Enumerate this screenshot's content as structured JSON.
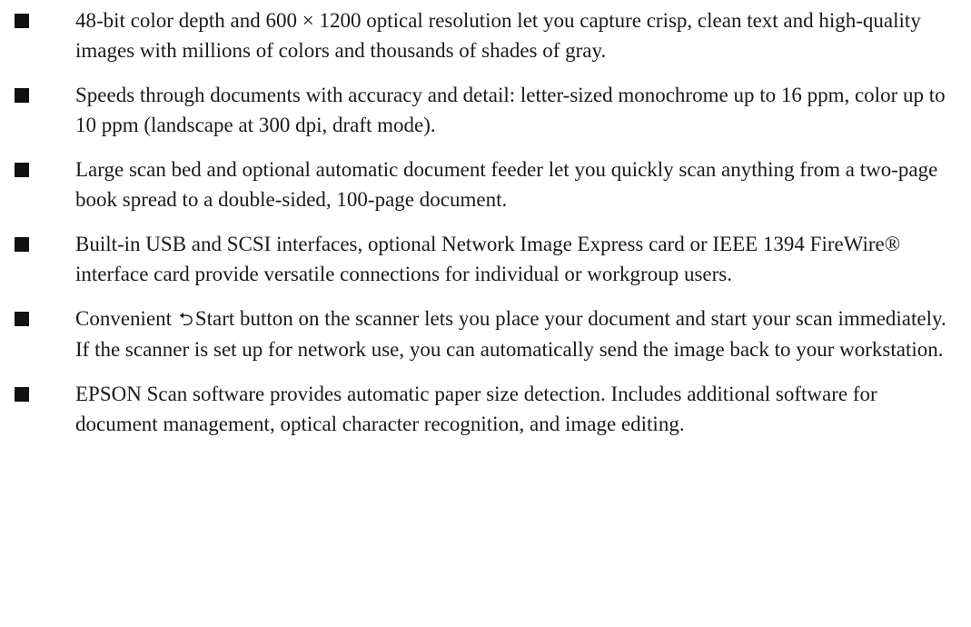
{
  "features": [
    "48-bit color depth and 600 × 1200 optical resolution let you capture crisp, clean text and high-quality images with millions of colors and thousands of shades of gray.",
    "Speeds through documents with accuracy and detail: letter-sized monochrome up to 16 ppm, color up to 10 ppm (landscape at 300 dpi, draft mode).",
    "Large scan bed and optional automatic document feeder let you quickly scan anything from a two-page book spread to a double-sided, 100-page document.",
    "Built-in USB and SCSI interfaces, optional Network Image Express card or IEEE 1394 FireWire® interface card provide versatile connections for individual or workgroup users.",
    {
      "before": "Convenient",
      "icon": "start-icon",
      "after": "Start button on the scanner lets you place your document and start your scan immediately. If the scanner is set up for network use, you can automatically send the image back to your workstation."
    },
    "EPSON Scan software provides automatic paper size detection. Includes additional software for document management, optical character recognition, and image editing."
  ]
}
